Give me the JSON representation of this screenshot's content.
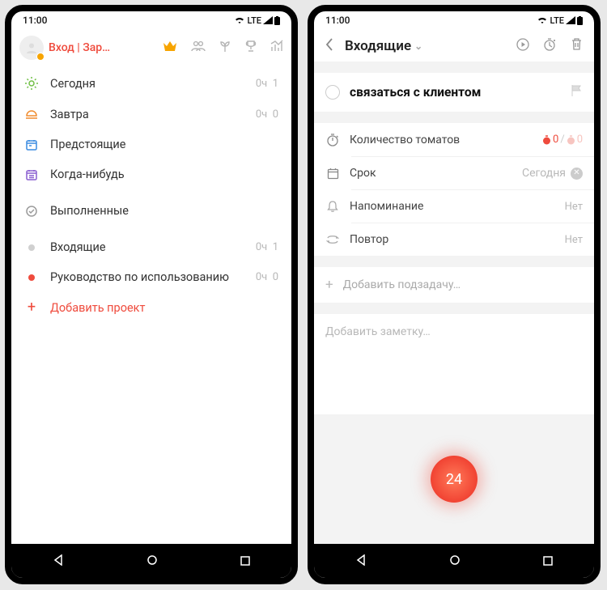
{
  "status": {
    "time": "11:00",
    "net": "LTE"
  },
  "screen1": {
    "login": "Вход | Зар…",
    "folders": [
      {
        "icon": "sun",
        "label": "Сегодня",
        "hours": "0ч",
        "count": "1"
      },
      {
        "icon": "sunset",
        "label": "Завтра",
        "hours": "0ч",
        "count": "0"
      },
      {
        "icon": "cal",
        "label": "Предстоящие",
        "hours": "",
        "count": ""
      },
      {
        "icon": "calp",
        "label": "Когда-нибудь",
        "hours": "",
        "count": ""
      }
    ],
    "done": {
      "label": "Выполненные"
    },
    "inbox": {
      "label": "Входящие",
      "hours": "0ч",
      "count": "1"
    },
    "guide": {
      "label": "Руководство по использованию",
      "hours": "0ч",
      "count": "0"
    },
    "add": {
      "label": "Добавить проект"
    }
  },
  "screen2": {
    "title": "Входящие",
    "task_title": "связаться с клиентом",
    "rows": {
      "pomo": {
        "label": "Количество томатов",
        "red": "0",
        "pink": "0"
      },
      "due": {
        "label": "Срок",
        "value": "Сегодня"
      },
      "remind": {
        "label": "Напоминание",
        "value": "Нет"
      },
      "repeat": {
        "label": "Повтор",
        "value": "Нет"
      }
    },
    "subtask_placeholder": "Добавить подзадачу…",
    "note_placeholder": "Добавить заметку…",
    "timer": "24"
  }
}
